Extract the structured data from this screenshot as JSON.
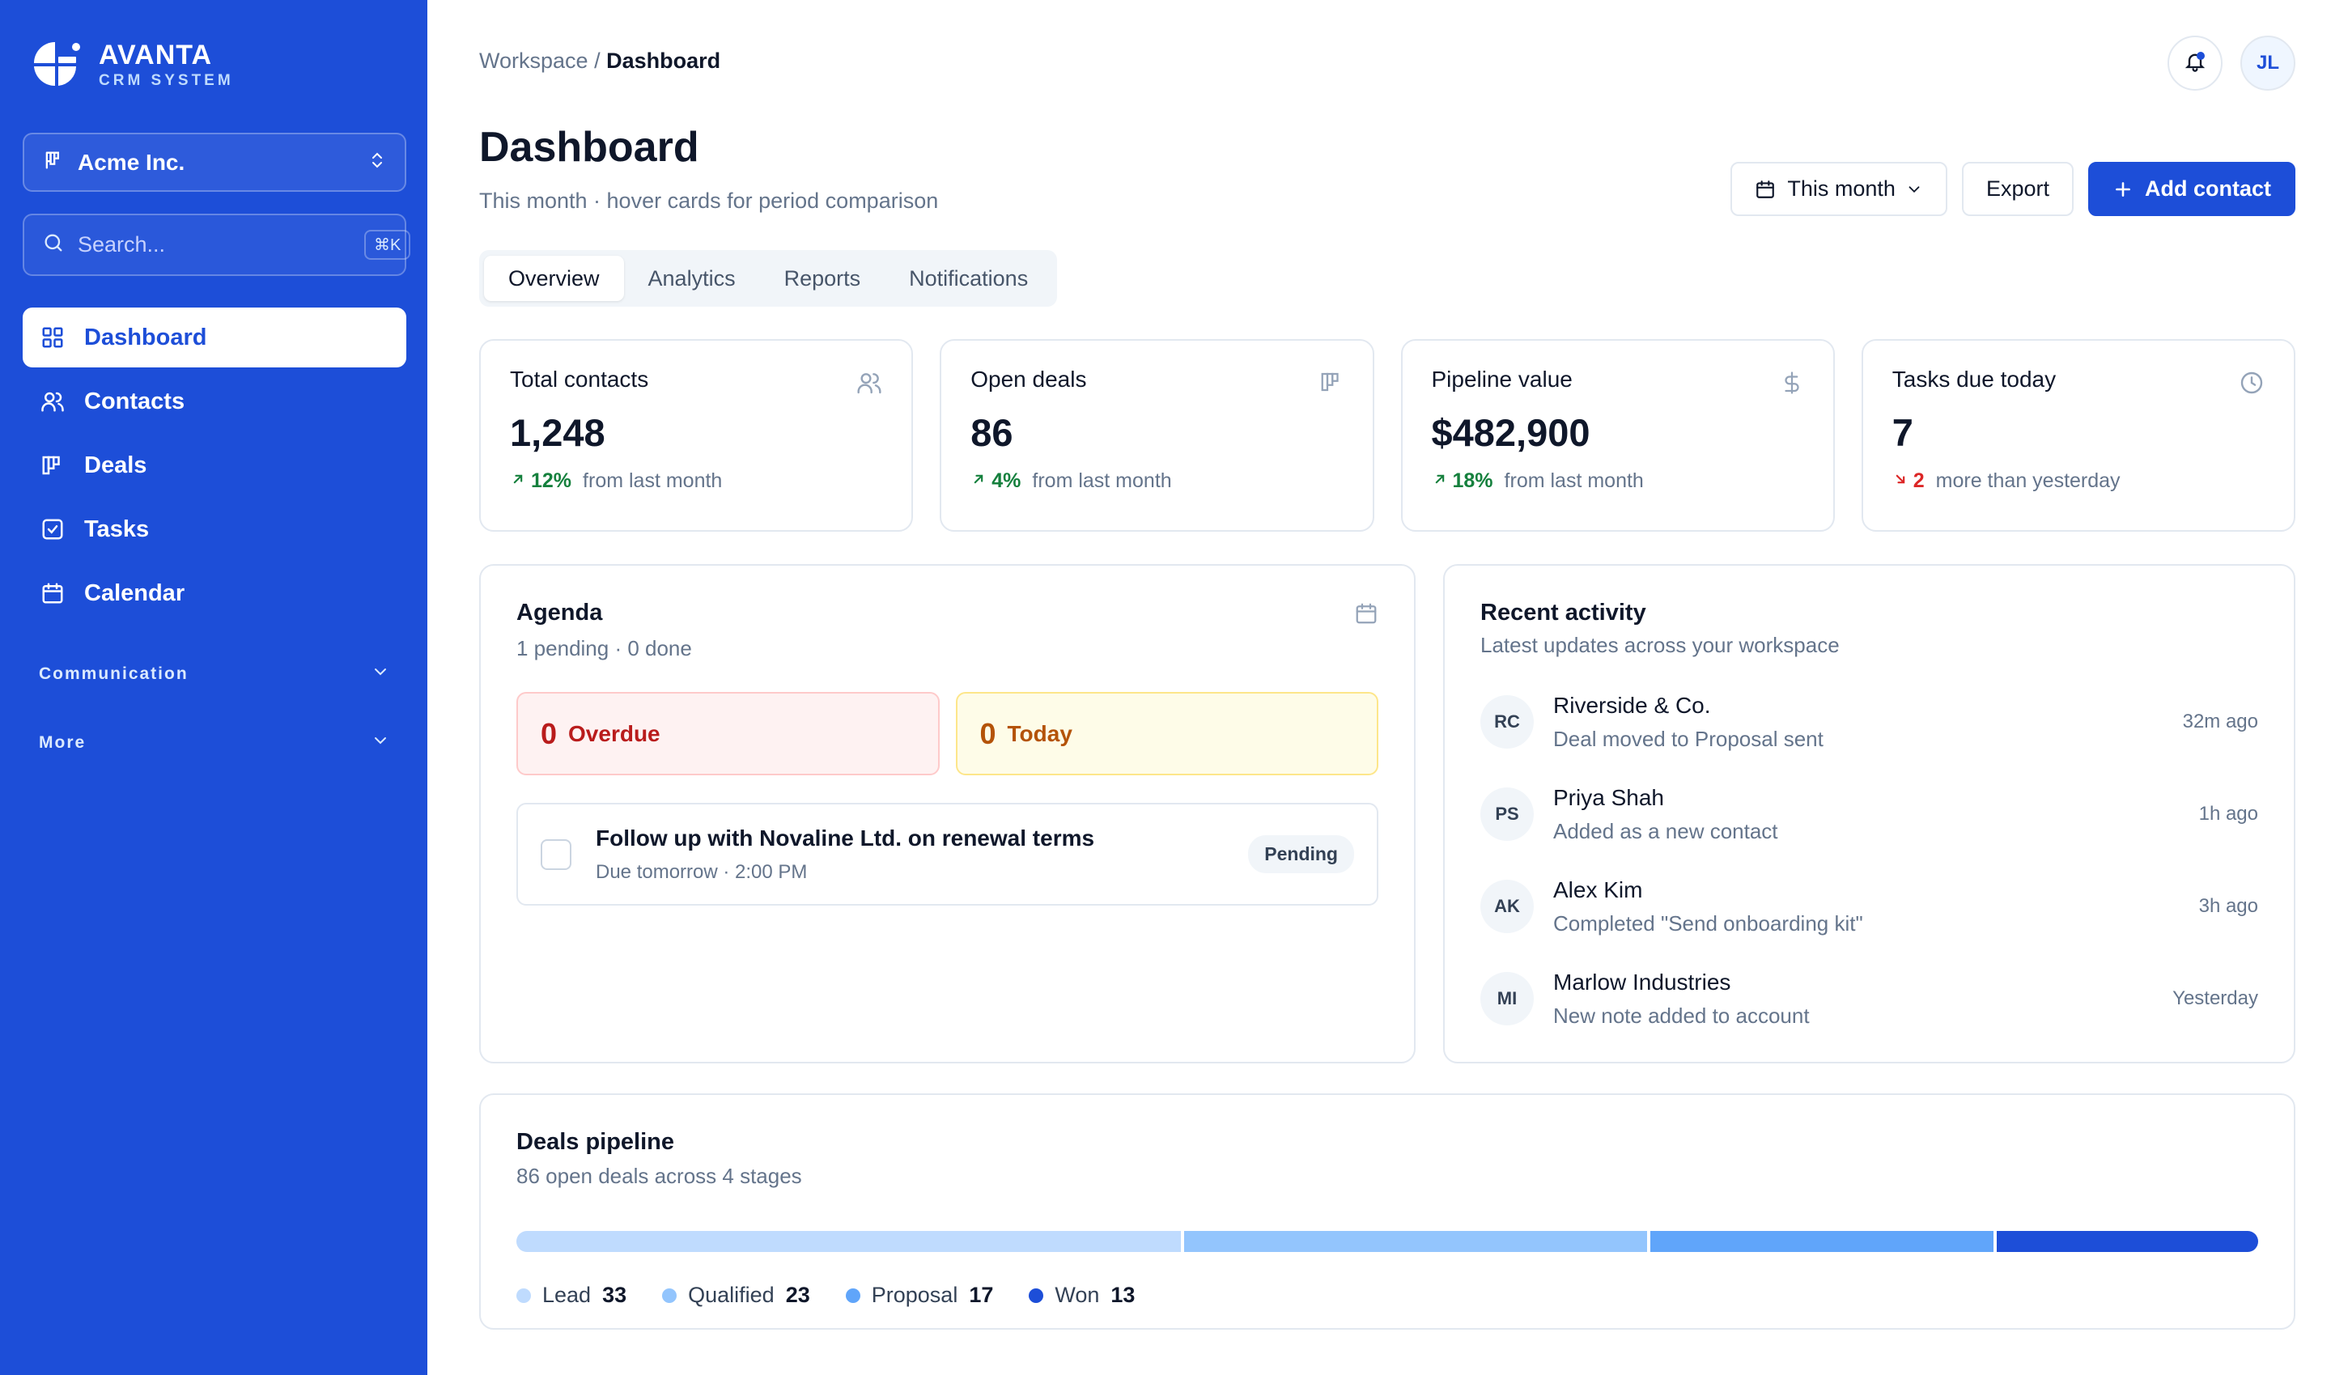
{
  "brand": {
    "name": "AVANTA",
    "subtitle": "CRM SYSTEM"
  },
  "sidebar": {
    "org": "Acme Inc.",
    "search": {
      "placeholder": "Search...",
      "shortcut": "⌘K"
    },
    "items": [
      {
        "label": "Dashboard",
        "icon": "grid-icon",
        "active": true
      },
      {
        "label": "Contacts",
        "icon": "users-icon"
      },
      {
        "label": "Deals",
        "icon": "kanban-icon"
      },
      {
        "label": "Tasks",
        "icon": "checkbox-icon"
      },
      {
        "label": "Calendar",
        "icon": "calendar-icon"
      }
    ],
    "sections": [
      {
        "label": "Communication"
      },
      {
        "label": "More"
      }
    ]
  },
  "header": {
    "breadcrumb": {
      "parent": "Workspace",
      "separator": "/",
      "current": "Dashboard"
    },
    "avatar_initials": "JL",
    "title": "Dashboard",
    "subtitle": "This month · hover cards for period comparison",
    "period_label": "This month",
    "export_label": "Export",
    "add_label": "Add contact"
  },
  "tabs": [
    {
      "label": "Overview",
      "active": true
    },
    {
      "label": "Analytics"
    },
    {
      "label": "Reports"
    },
    {
      "label": "Notifications"
    }
  ],
  "kpis": [
    {
      "label": "Total contacts",
      "value": "1,248",
      "delta": "12%",
      "delta_text": "from last month",
      "direction": "up",
      "icon": "users-icon"
    },
    {
      "label": "Open deals",
      "value": "86",
      "delta": "4%",
      "delta_text": "from last month",
      "direction": "up",
      "icon": "kanban-icon"
    },
    {
      "label": "Pipeline value",
      "value": "$482,900",
      "delta": "18%",
      "delta_text": "from last month",
      "direction": "up",
      "icon": "dollar-icon"
    },
    {
      "label": "Tasks due today",
      "value": "7",
      "delta": "2",
      "delta_text": "more than yesterday",
      "direction": "down",
      "icon": "clock-icon"
    }
  ],
  "agenda": {
    "title": "Agenda",
    "summary": "1 pending · 0 done",
    "overdue": {
      "count": "0",
      "label": "Overdue"
    },
    "today": {
      "count": "0",
      "label": "Today"
    },
    "tasks": [
      {
        "title": "Follow up with Novaline Ltd. on renewal terms",
        "due": "Due tomorrow · 2:00 PM",
        "status": "Pending"
      }
    ]
  },
  "activity": {
    "title": "Recent activity",
    "subtitle": "Latest updates across your workspace",
    "items": [
      {
        "initials": "RC",
        "name": "Riverside & Co.",
        "desc": "Deal moved to Proposal sent",
        "time": "32m ago"
      },
      {
        "initials": "PS",
        "name": "Priya Shah",
        "desc": "Added as a new contact",
        "time": "1h ago"
      },
      {
        "initials": "AK",
        "name": "Alex Kim",
        "desc": "Completed \"Send onboarding kit\"",
        "time": "3h ago"
      },
      {
        "initials": "MI",
        "name": "Marlow Industries",
        "desc": "New note added to account",
        "time": "Yesterday"
      }
    ]
  },
  "pipeline": {
    "title": "Deals pipeline",
    "subtitle": "86 open deals across 4 stages",
    "stages": [
      {
        "label": "Lead",
        "count": 33,
        "color": "#bfdbfe"
      },
      {
        "label": "Qualified",
        "count": 23,
        "color": "#93c5fd"
      },
      {
        "label": "Proposal",
        "count": 17,
        "color": "#60a5fa"
      },
      {
        "label": "Won",
        "count": 13,
        "color": "#1d4ed8"
      }
    ]
  },
  "colors": {
    "brand": "#1d4ed8",
    "up": "#15803d",
    "down": "#dc2626"
  }
}
